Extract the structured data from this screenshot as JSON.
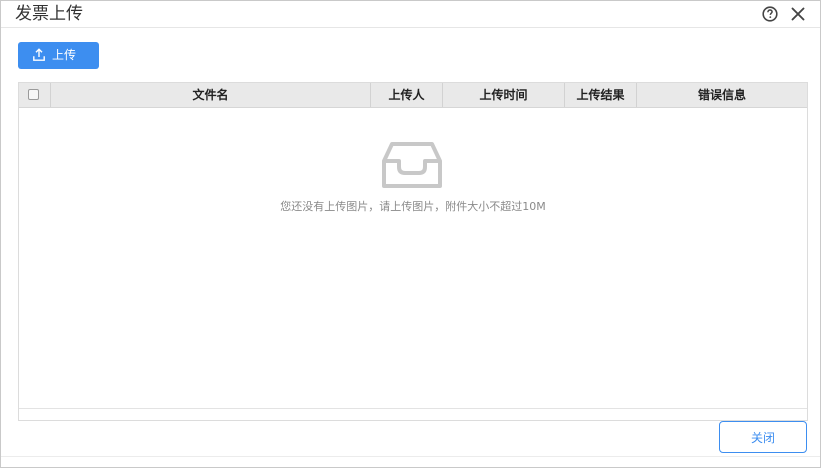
{
  "dialog": {
    "title": "发票上传"
  },
  "toolbar": {
    "upload_label": "上传"
  },
  "table": {
    "columns": [
      "",
      "文件名",
      "上传人",
      "上传时间",
      "上传结果",
      "错误信息"
    ],
    "rows": [],
    "empty_text": "您还没有上传图片，请上传图片，附件大小不超过10M"
  },
  "footer": {
    "close_label": "关闭"
  },
  "colors": {
    "accent": "#3d8ef0",
    "header_bg": "#e9e9e9",
    "empty_icon": "#c8c8c8"
  },
  "icons": {
    "help": "help-circle-icon",
    "close": "close-icon",
    "upload": "upload-icon",
    "empty": "empty-inbox-icon"
  }
}
